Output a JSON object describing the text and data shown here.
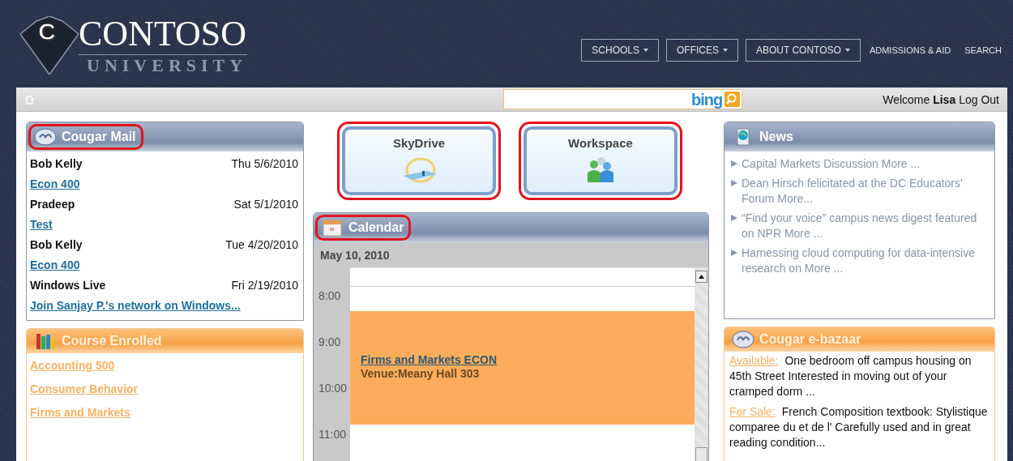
{
  "header": {
    "logo": {
      "letter": "C",
      "name": "CONTOSO",
      "subtitle": "UNIVERSITY"
    },
    "nav": [
      {
        "label": "SCHOOLS",
        "kind": "dropdown"
      },
      {
        "label": "OFFICES",
        "kind": "dropdown"
      },
      {
        "label": "ABOUT CONTOSO",
        "kind": "dropdown"
      },
      {
        "label": "ADMISSIONS & AID",
        "kind": "link"
      },
      {
        "label": "SEARCH",
        "kind": "link"
      }
    ]
  },
  "toolbar": {
    "search": {
      "brand": "bing"
    },
    "welcome": "Welcome **Lisa**",
    "logout": "Log Out"
  },
  "mail": {
    "title": "Cougar Mail",
    "highlighted": true,
    "messages": [
      {
        "sender": "Bob Kelly",
        "date": "Thu 5/6/2010",
        "subject": "Econ 400"
      },
      {
        "sender": "Pradeep",
        "date": "Sat 5/1/2010",
        "subject": "Test"
      },
      {
        "sender": "Bob Kelly",
        "date": "Tue 4/20/2010",
        "subject": "Econ 400"
      },
      {
        "sender": "Windows Live",
        "date": "Fri 2/19/2010",
        "subject": "Join Sanjay P.'s network on Windows..."
      }
    ]
  },
  "courses": {
    "title": "Course Enrolled",
    "highlighted": false,
    "items": [
      "Accounting 500",
      "Consumer Behavior",
      "Firms and Markets"
    ]
  },
  "tiles": [
    {
      "label": "SkyDrive",
      "kind": "skydrive",
      "highlighted": true
    },
    {
      "label": "Workspace",
      "kind": "workspace",
      "highlighted": true
    }
  ],
  "calendar": {
    "title": "Calendar",
    "highlighted": true,
    "date": "May 10, 2010",
    "hours": [
      "8:00",
      "9:00",
      "10:00",
      "11:00"
    ],
    "events": [
      {
        "title": "Firms and Markets ECON",
        "venue": "Venue:Meany Hall 303"
      }
    ]
  },
  "news": {
    "title": "News",
    "highlighted": false,
    "items": [
      "Capital Markets Discussion More ...",
      "Dean Hirsch felicitated at the DC Educators' Forum More...",
      "“Find your voice” campus news digest featured on NPR More ...",
      "Harnessing cloud computing for data-intensive research on More ..."
    ]
  },
  "bazaar": {
    "title": "Cougar e-bazaar",
    "highlighted": false,
    "listings": [
      {
        "tag": "Available:",
        "text": "One bedroom off campus housing on 45th Street Interested in moving out of your cramped dorm ..."
      },
      {
        "tag": "For Sale:",
        "text": "French Composition textbook: Stylistique comparee du et de l' Carefully used and in great reading condition..."
      }
    ]
  }
}
